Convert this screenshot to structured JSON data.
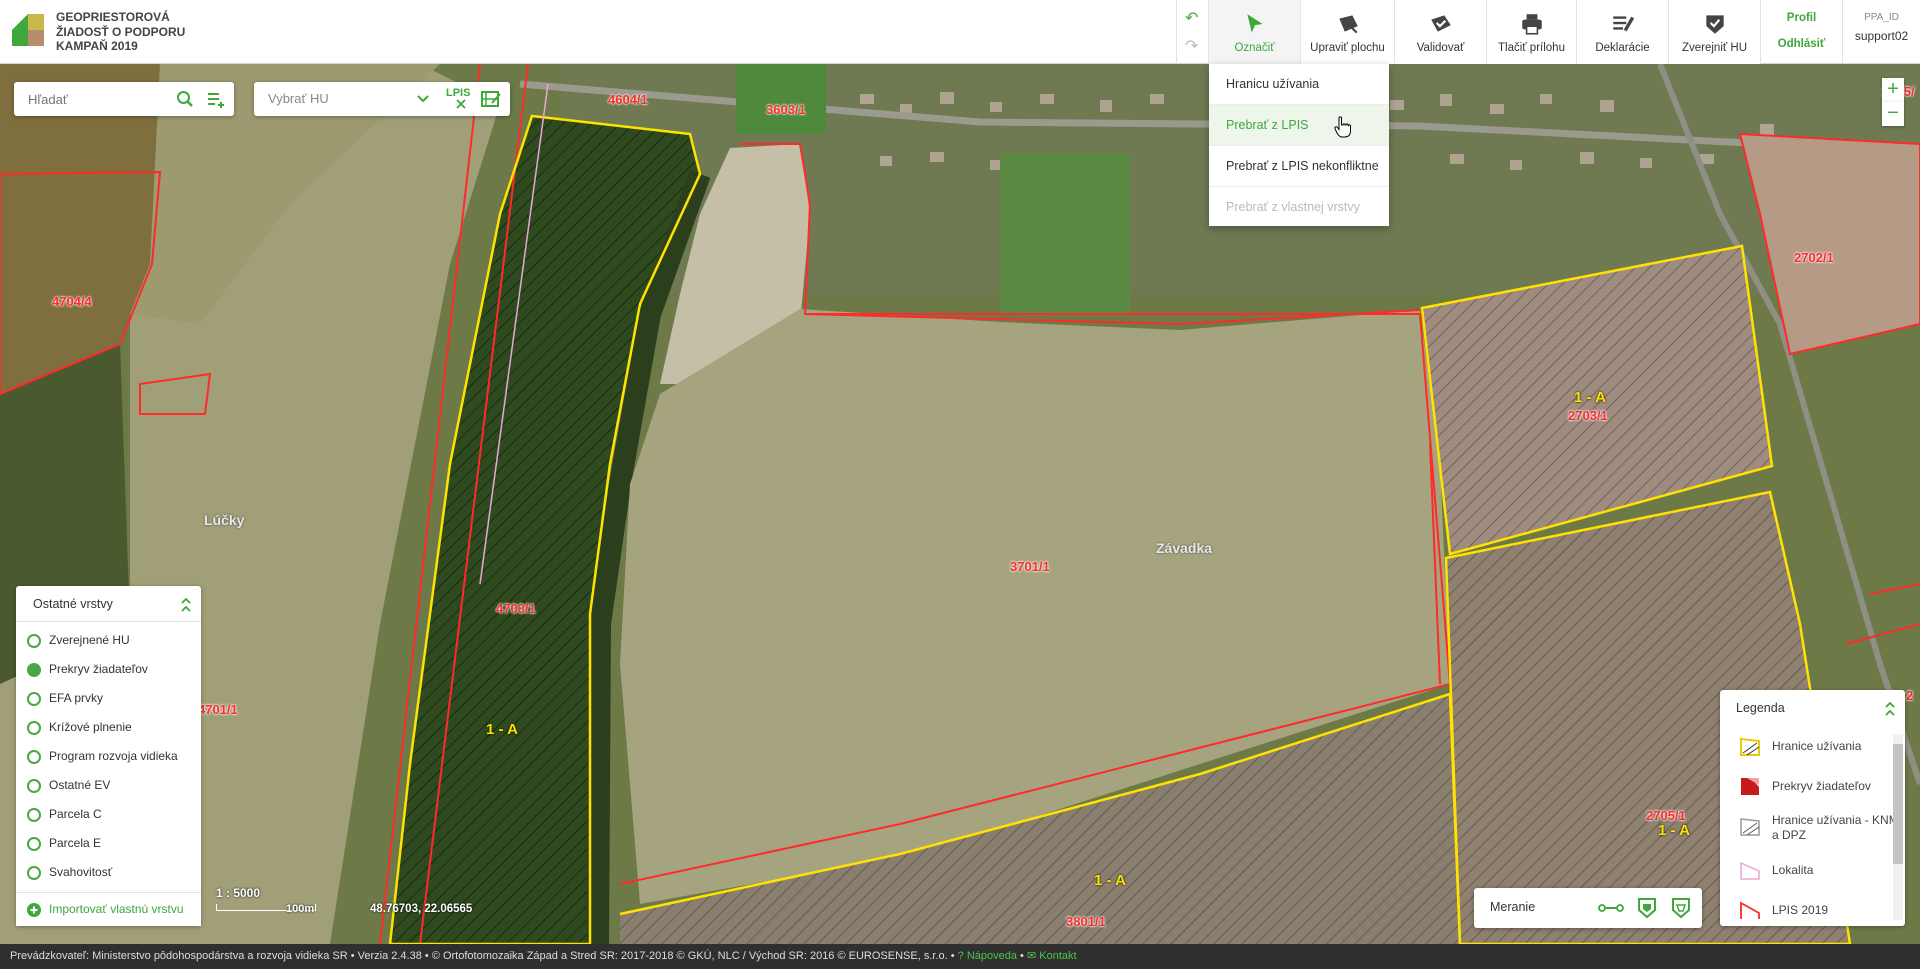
{
  "app": {
    "title_line1": "GEOPRIESTOROVÁ",
    "title_line2": "ŽIADOSŤ O PODPORU",
    "title_line3": "KAMPAŇ 2019"
  },
  "toolbar": {
    "buttons": [
      {
        "label": "Označiť",
        "icon": "cursor-arrow-icon",
        "active": true
      },
      {
        "label": "Upraviť plochu",
        "icon": "edit-area-icon"
      },
      {
        "label": "Validovať",
        "icon": "validate-icon"
      },
      {
        "label": "Tlačiť prílohu",
        "icon": "printer-icon"
      },
      {
        "label": "Deklarácie",
        "icon": "declarations-icon"
      },
      {
        "label": "Zverejniť HU",
        "icon": "publish-shield-icon"
      }
    ],
    "profile_label": "Profil",
    "logout_label": "Odhlásiť",
    "user_id_label": "PPA_ID",
    "username": "support02"
  },
  "dropdown": {
    "items": [
      {
        "label": "Hranicu užívania",
        "state": "normal"
      },
      {
        "label": "Prebrať z LPIS",
        "state": "hover"
      },
      {
        "label": "Prebrať z LPIS nekonfliktne",
        "state": "normal"
      },
      {
        "label": "Prebrať z vlastnej vrstvy",
        "state": "disabled"
      }
    ]
  },
  "search": {
    "placeholder": "Hľadať"
  },
  "hu_select": {
    "placeholder": "Vybrať HU",
    "lpis_label": "LPIS"
  },
  "map": {
    "parcel_labels": [
      "4604/1",
      "3603/1",
      "4704/4",
      "4703/1",
      "3701/1",
      "2702/1",
      "2703/1",
      "2605/",
      "2705/1",
      "3801/1",
      "4701/1",
      "2"
    ],
    "usage_labels": [
      "1 - A",
      "1 - A",
      "1 - A",
      "1 - A"
    ],
    "place_labels": [
      "Lúčky",
      "Závadka"
    ],
    "scale": "1 : 5000",
    "scale_distance": "100m",
    "coordinates": "48.76703, 22.06565"
  },
  "layers_panel": {
    "title": "Ostatné vrstvy",
    "items": [
      {
        "label": "Zverejnené HU",
        "checked": false
      },
      {
        "label": "Prekryv žiadateľov",
        "checked": true
      },
      {
        "label": "EFA prvky",
        "checked": false
      },
      {
        "label": "Krížové plnenie",
        "checked": false
      },
      {
        "label": "Program rozvoja vidieka",
        "checked": false
      },
      {
        "label": "Ostatné EV",
        "checked": false
      },
      {
        "label": "Parcela C",
        "checked": false
      },
      {
        "label": "Parcela E",
        "checked": false
      },
      {
        "label": "Svahovitosť",
        "checked": false
      }
    ],
    "import_label": "Importovať vlastnú vrstvu"
  },
  "legend": {
    "title": "Legenda",
    "items": [
      {
        "label": "Hranice užívania"
      },
      {
        "label": "Prekryv žiadateľov"
      },
      {
        "label": "Hranice užívania - KNM a DPZ"
      },
      {
        "label": "Lokalita"
      },
      {
        "label": "LPIS 2019"
      }
    ]
  },
  "measure": {
    "label": "Meranie"
  },
  "footer": {
    "text": "Prevádzkovateľ: Ministerstvo pôdohospodárstva a rozvoja vidieka SR • Verzia 2.4.38 • © Ortofotomozaika Západ a Stred SR: 2017-2018 © GKÚ, NLC / Východ SR: 2016 © EUROSENSE, s.r.o. •",
    "help_label": "Nápoveda",
    "contact_label": "Kontakt"
  },
  "colors": {
    "accent": "#3ea83b",
    "parcel_border": "#ff2a2a",
    "usage_border": "#ffe200"
  }
}
